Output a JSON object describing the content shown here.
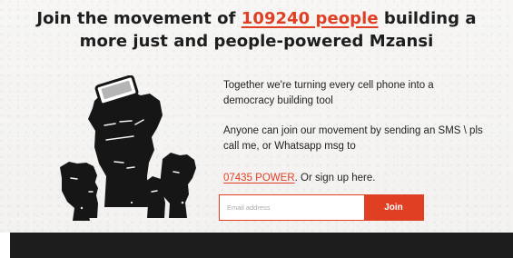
{
  "hero": {
    "title_prefix": "Join the movement of ",
    "member_count_link": "109240 people",
    "title_suffix": " building a more just and people-powered Mzansi"
  },
  "description": {
    "line_1": "Together we're turning every cell phone into a democracy building tool",
    "line_2": "Anyone can join our movement by sending an SMS \\ pls call me, or Whatsapp msg to",
    "phone_link": "07435 POWER",
    "line_3_suffix": ". Or sign up here."
  },
  "signup": {
    "email_placeholder": "Email address",
    "join_label": "Join"
  },
  "colors": {
    "accent": "#e13f24",
    "footer": "#1d1d1d"
  },
  "icons": {
    "hero_illustration": "raised-fists-with-phone-icon"
  }
}
